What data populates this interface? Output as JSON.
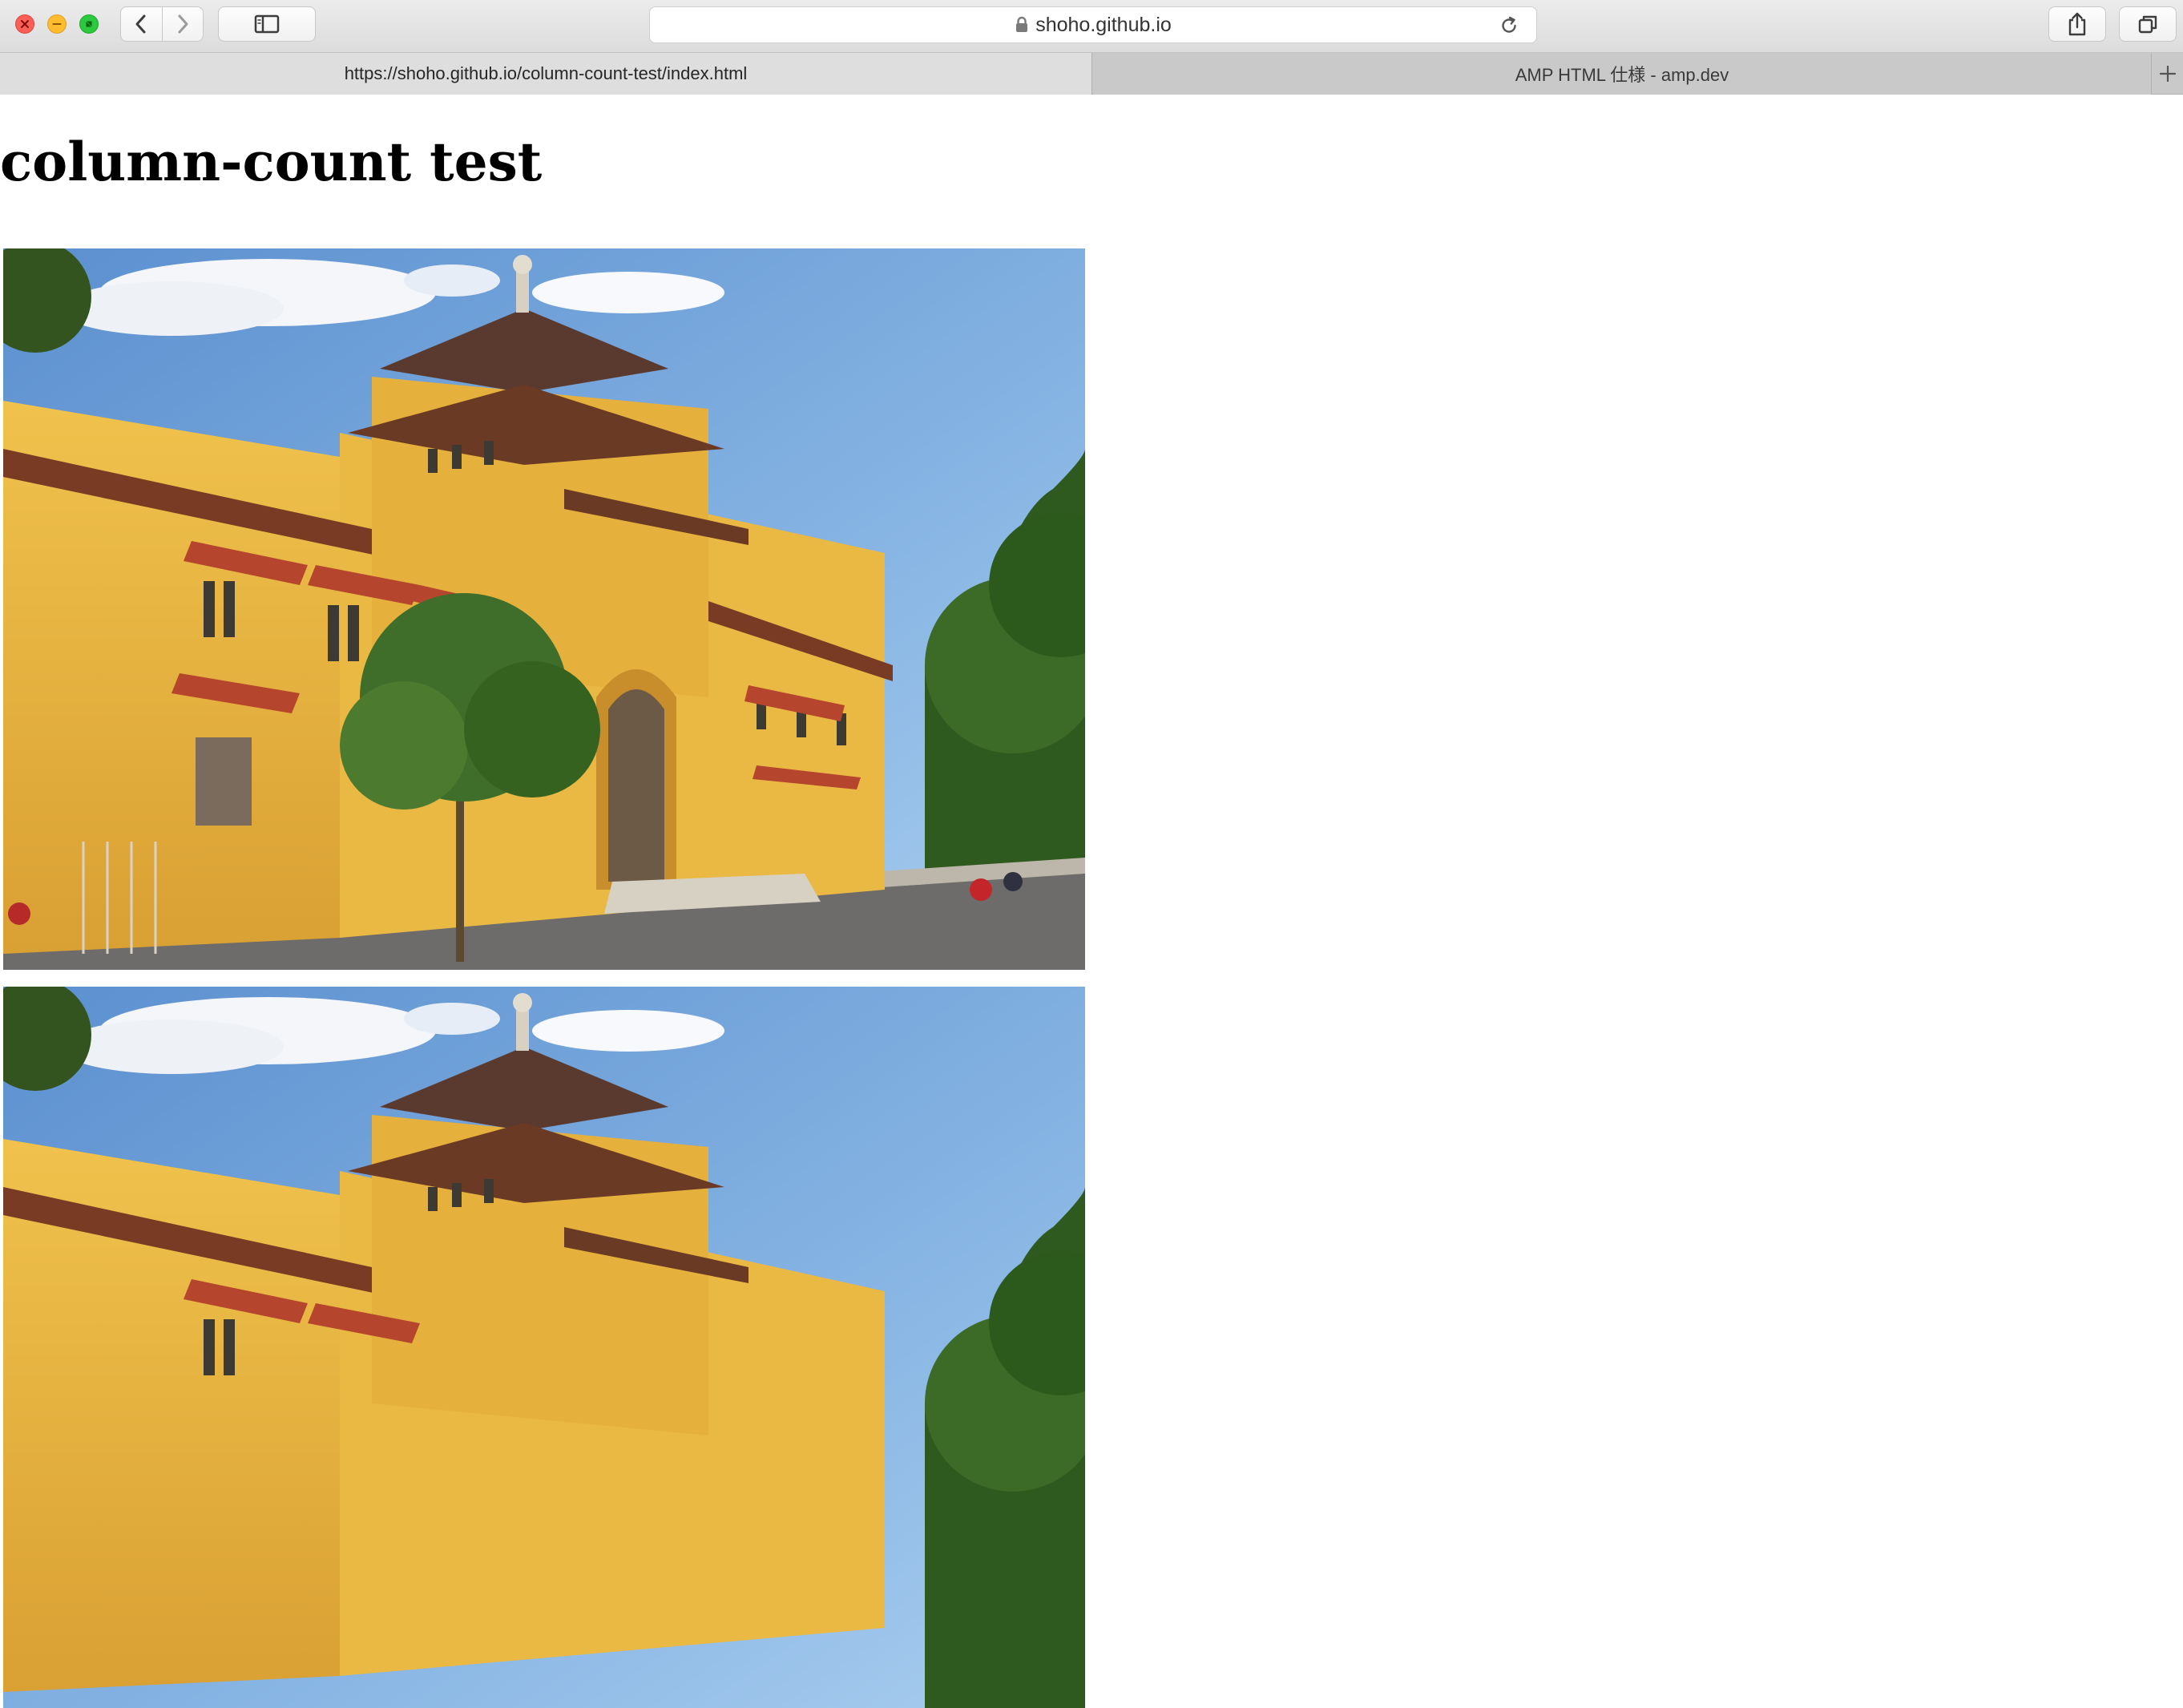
{
  "window": {
    "close_icon": "close-icon",
    "minimize_icon": "minimize-icon",
    "zoom_icon": "zoom-icon"
  },
  "toolbar": {
    "back_icon": "chevron-left-icon",
    "forward_icon": "chevron-right-icon",
    "sidebar_icon": "sidebar-icon",
    "address": "shoho.github.io",
    "lock_icon": "lock-icon",
    "reload_icon": "reload-icon",
    "share_icon": "share-icon",
    "tabs_icon": "tabs-overview-icon"
  },
  "tabs": [
    {
      "label": "https://shoho.github.io/column-count-test/index.html",
      "active": true
    },
    {
      "label": "AMP HTML 仕様 - amp.dev",
      "active": false
    }
  ],
  "new_tab_icon": "plus-icon",
  "page": {
    "title": "column-count test",
    "images": [
      {
        "alt": "yellow colonial building photo"
      },
      {
        "alt": "yellow colonial building photo"
      }
    ]
  },
  "colors": {
    "close": "#fd5e57",
    "minimize": "#febc2e",
    "zoom": "#2bc840",
    "building": "#e7b13d",
    "sky": "#6fa3d8"
  }
}
